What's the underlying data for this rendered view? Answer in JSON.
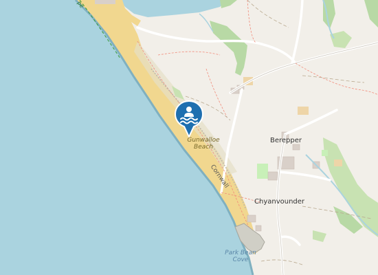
{
  "map": {
    "places": {
      "gunwalloe_beach_line1": "Gunwalloe",
      "gunwalloe_beach_line2": "Beach",
      "berepper": "Berepper",
      "chyanvounder": "Chyanvounder",
      "park_bean_line1": "Park Bean",
      "park_bean_line2": "Cove",
      "cornwall": "Cornwall",
      "path_fragment": "pe"
    },
    "marker": {
      "type": "swimming",
      "icon": "swimming-icon",
      "color": "#1e6fb0"
    },
    "colors": {
      "sea": "#aad3df",
      "land": "#f2efe9",
      "beach": "#f1d78f",
      "woodland": "#b8d9a5",
      "road": "#ffffff"
    }
  }
}
